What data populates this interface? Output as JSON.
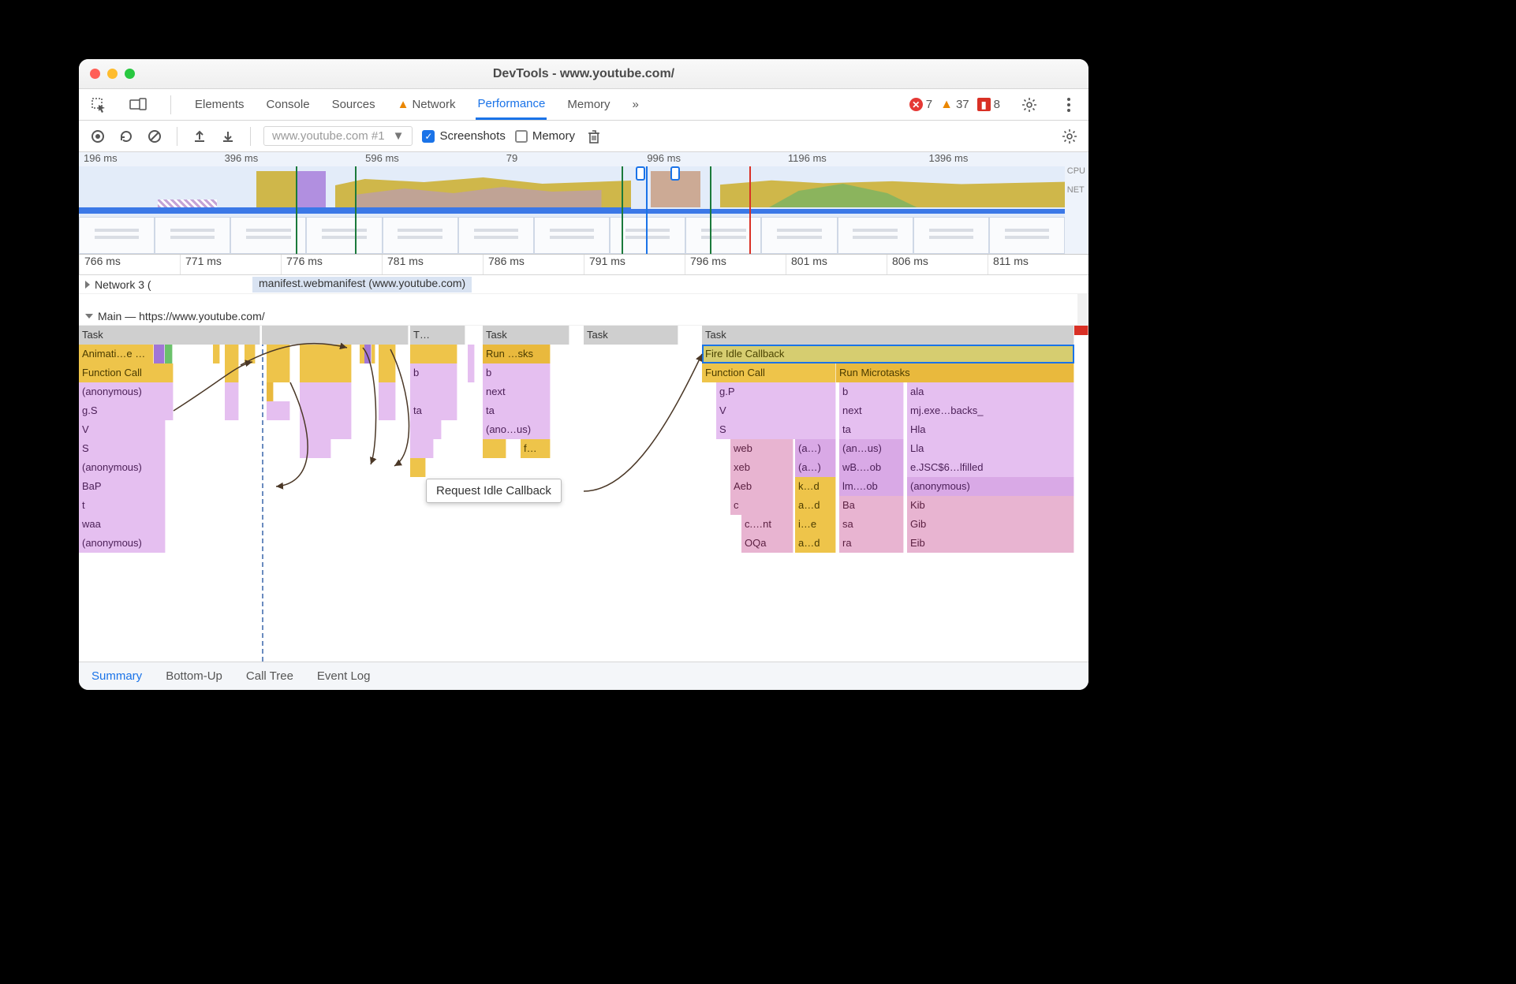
{
  "window": {
    "title": "DevTools - www.youtube.com/"
  },
  "tabs": {
    "items": [
      "Elements",
      "Console",
      "Sources",
      "Network",
      "Performance",
      "Memory"
    ],
    "active": "Performance",
    "network_has_warning": true,
    "overflow": "»"
  },
  "status": {
    "errors": 7,
    "warnings": 37,
    "issues": 8
  },
  "perf_toolbar": {
    "session_label": "www.youtube.com #1",
    "screenshots_label": "Screenshots",
    "screenshots_checked": true,
    "memory_label": "Memory",
    "memory_checked": false
  },
  "overview": {
    "ticks": [
      "196 ms",
      "396 ms",
      "596 ms",
      "79",
      "996 ms",
      "1196 ms",
      "1396 ms"
    ],
    "right_labels": [
      "CPU",
      "NET"
    ]
  },
  "ruler": {
    "ticks": [
      "766 ms",
      "771 ms",
      "776 ms",
      "781 ms",
      "786 ms",
      "791 ms",
      "796 ms",
      "801 ms",
      "806 ms",
      "811 ms"
    ]
  },
  "network_track": {
    "label": "Network 3 (",
    "entry": "manifest.webmanifest (www.youtube.com)"
  },
  "main_track": {
    "label": "Main — https://www.youtube.com/"
  },
  "tooltip": "Request Idle Callback",
  "bottom_tabs": {
    "items": [
      "Summary",
      "Bottom-Up",
      "Call Tree",
      "Event Log"
    ],
    "active": "Summary"
  },
  "flame": {
    "col1": {
      "r0": "Task",
      "r1": "Animati…e Fired",
      "r2": "Function Call",
      "r3": "(anonymous)",
      "r4": "g.S",
      "r5": "V",
      "r6": "S",
      "r7": "(anonymous)",
      "r8": "BaP",
      "r9": "t",
      "r10": "waa",
      "r11": "(anonymous)"
    },
    "col2": {
      "r0": "T…",
      "r2": "b",
      "r4": "ta"
    },
    "col3": {
      "r0": "Task",
      "r1": "Run …sks",
      "r2": "b",
      "r3": "next",
      "r4": "ta",
      "r5": "(ano…us)",
      "r6": "f…"
    },
    "col4": {
      "r0": "Task"
    },
    "col5": {
      "r0": "Task",
      "r1": "Fire Idle Callback",
      "left": {
        "r2": "Function Call",
        "r3": "g.P",
        "r4": "V",
        "r5": "S",
        "r6a": "web",
        "r6b": "(a…)",
        "r7a": "xeb",
        "r7b": "(a…)",
        "r8a": "Aeb",
        "r8b": "k…d",
        "r9a": "c",
        "r9b": "a…d",
        "r10a": "c.…nt",
        "r10b": "i…e",
        "r11a": "OQa",
        "r11b": "a…d"
      },
      "mid": {
        "r2": "",
        "r3": "b",
        "r4": "next",
        "r5": "ta",
        "r6": "(an…us)",
        "r7": "wB.…ob",
        "r8": "lm.…ob",
        "r9": "Ba",
        "r10": "sa",
        "r11": "ra"
      },
      "right": {
        "r2": "Run Microtasks",
        "r3": "ala",
        "r4": "mj.exe…backs_",
        "r5": "Hla",
        "r6": "Lla",
        "r7": "e.JSC$6…lfilled",
        "r8": "(anonymous)",
        "r9": "Kib",
        "r10": "Gib",
        "r11": "Eib"
      }
    }
  }
}
